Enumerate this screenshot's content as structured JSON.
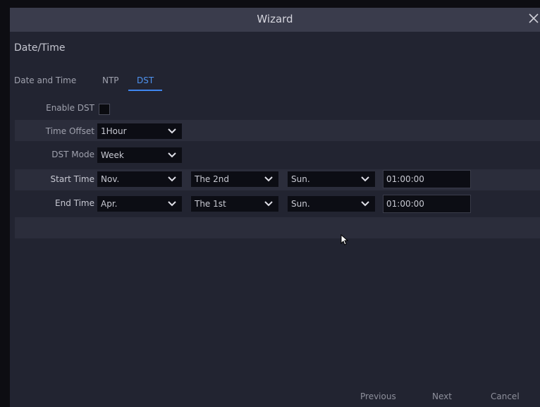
{
  "window": {
    "title": "Wizard"
  },
  "section": {
    "title": "Date/Time"
  },
  "tabs": [
    {
      "label": "Date and Time"
    },
    {
      "label": "NTP"
    },
    {
      "label": "DST"
    }
  ],
  "dst": {
    "enable_label": "Enable DST",
    "enabled": false,
    "time_offset_label": "Time Offset",
    "time_offset_value": "1Hour",
    "mode_label": "DST Mode",
    "mode_value": "Week",
    "start_label": "Start Time",
    "start": {
      "month": "Nov.",
      "week": "The 2nd",
      "day": "Sun.",
      "time": "01:00:00"
    },
    "end_label": "End Time",
    "end": {
      "month": "Apr.",
      "week": "The 1st",
      "day": "Sun.",
      "time": "01:00:00"
    }
  },
  "buttons": {
    "previous": "Previous",
    "next": "Next",
    "cancel": "Cancel"
  },
  "icons": {
    "close": "close-icon",
    "dropdown": "chevron-down-icon",
    "pointer": "mouse-pointer-icon"
  },
  "colors": {
    "accent": "#3f86f0",
    "background": "#222431",
    "titlebar": "#3a3c4c"
  }
}
